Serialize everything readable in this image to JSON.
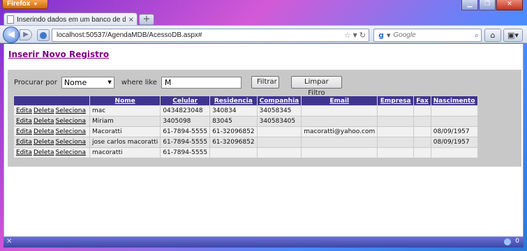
{
  "browser": {
    "menu_button": "Firefox",
    "tab_title": "Inserindo dados em um banco de dados...",
    "url": "localhost:50537/AgendaMDB/AcessoDB.aspx#",
    "search_placeholder": "Google",
    "search_engine_icon": "google-icon",
    "status_count": "0"
  },
  "page": {
    "insert_link": "Inserir Novo Registro",
    "filter": {
      "search_by_label": "Procurar por",
      "field_value": "Nome",
      "where_label": "where like",
      "text_value": "M",
      "filter_button": "Filtrar",
      "clear_button": "Limpar Filtro"
    },
    "grid": {
      "columns": [
        "",
        "Nome",
        "Celular",
        "Residencia",
        "Companhia",
        "Email",
        "Empresa",
        "Fax",
        "Nascimento"
      ],
      "action_links": [
        "Edita",
        "Deleta",
        "Seleciona"
      ],
      "rows": [
        {
          "nome": "mac",
          "celular": "0434823048",
          "residencia": "340834",
          "companhia": "34058345",
          "email": "",
          "empresa": "",
          "fax": "",
          "nascimento": ""
        },
        {
          "nome": "Miriam",
          "celular": "3405098",
          "residencia": "83045",
          "companhia": "340583405",
          "email": "",
          "empresa": "",
          "fax": "",
          "nascimento": ""
        },
        {
          "nome": "Macoratti",
          "celular": "61-7894-5555",
          "residencia": "61-32096852",
          "companhia": "",
          "email": "macoratti@yahoo.com",
          "empresa": "",
          "fax": "",
          "nascimento": "08/09/1957"
        },
        {
          "nome": "jose carlos macoratti",
          "celular": "61-7894-5555",
          "residencia": "61-32096852",
          "companhia": "",
          "email": "",
          "empresa": "",
          "fax": "",
          "nascimento": "08/09/1957"
        },
        {
          "nome": "macoratti",
          "celular": "61-7894-5555",
          "residencia": "",
          "companhia": "",
          "email": "",
          "empresa": "",
          "fax": "",
          "nascimento": ""
        }
      ]
    }
  },
  "colors": {
    "header_bg": "#3f358e",
    "panel_bg": "#c8c8c8",
    "link_visited": "#800080"
  }
}
